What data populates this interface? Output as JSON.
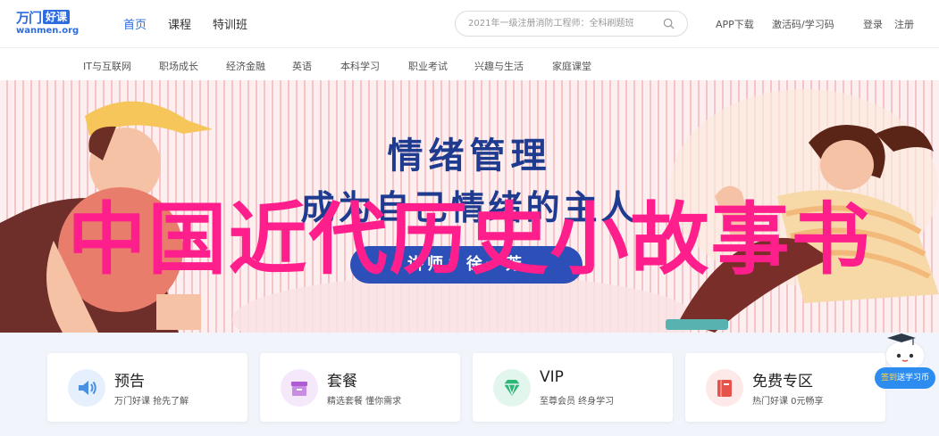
{
  "logo": {
    "brand_a": "万门",
    "brand_b": "好课",
    "domain": "wanmen.org"
  },
  "nav": [
    {
      "label": "首页",
      "active": true
    },
    {
      "label": "课程",
      "active": false
    },
    {
      "label": "特训班",
      "active": false
    }
  ],
  "search": {
    "placeholder": "2021年一级注册消防工程师：全科刷题班"
  },
  "header_links": {
    "app": "APP下载",
    "code": "激活码/学习码",
    "login": "登录",
    "register": "注册"
  },
  "categories": [
    "IT与互联网",
    "职场成长",
    "经济金融",
    "英语",
    "本科学习",
    "职业考试",
    "兴趣与生活",
    "家庭课堂"
  ],
  "banner": {
    "title": "情绪管理",
    "subtitle": "成为自己情绪的主人",
    "teacher": "讲师：徐一芳",
    "overlay": "中国近代历史小故事书"
  },
  "cards": [
    {
      "title": "预告",
      "desc": "万门好课 抢先了解",
      "icon": "speaker-icon",
      "color": "#4a90e2",
      "bg": "#e6f0fd"
    },
    {
      "title": "套餐",
      "desc": "精选套餐 懂你需求",
      "icon": "basket-icon",
      "color": "#b05bd6",
      "bg": "#f5e8fb"
    },
    {
      "title": "VIP",
      "desc": "至尊会员 终身学习",
      "icon": "diamond-icon",
      "color": "#2fb77a",
      "bg": "#e3f6ed"
    },
    {
      "title": "免费专区",
      "desc": "热门好课 0元畅享",
      "icon": "book-icon",
      "color": "#e5534b",
      "bg": "#fde9e8"
    }
  ],
  "float_badge": {
    "label_a": "签到",
    "label_b": "送学习币"
  },
  "colors": {
    "accent": "#2d6cdf",
    "overlay": "#ff1f8c",
    "banner_text": "#1f3b8f"
  }
}
